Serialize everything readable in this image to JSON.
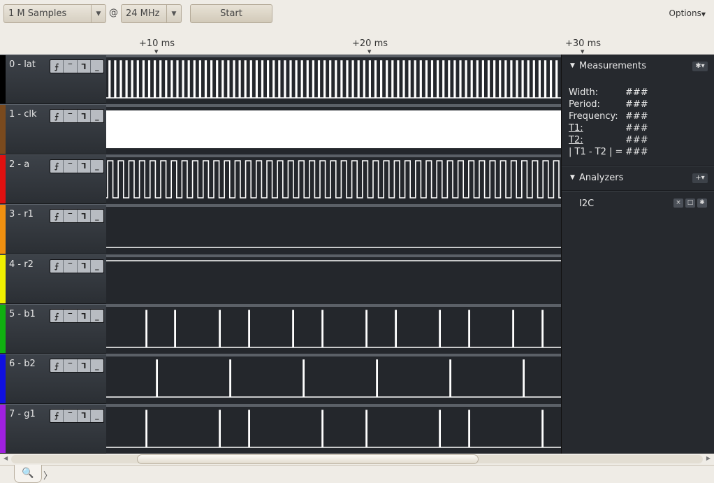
{
  "toolbar": {
    "samples": "1 M Samples",
    "at": "@",
    "rate": "24 MHz",
    "start_label": "Start",
    "options_label": "Options"
  },
  "ruler": {
    "ticks": [
      "+10 ms",
      "+20 ms",
      "+30 ms"
    ]
  },
  "channels": [
    {
      "name": "0 - lat",
      "color": "#000000",
      "signal": "fast-pulses"
    },
    {
      "name": "1 - clk",
      "color": "#7a4a1e",
      "signal": "dense-clock"
    },
    {
      "name": "2 - a",
      "color": "#e01010",
      "signal": "square-wave"
    },
    {
      "name": "3 - r1",
      "color": "#f09010",
      "signal": "low"
    },
    {
      "name": "4 - r2",
      "color": "#f0f000",
      "signal": "high"
    },
    {
      "name": "5 - b1",
      "color": "#10b010",
      "signal": "spikes"
    },
    {
      "name": "6 - b2",
      "color": "#1010e0",
      "signal": "spikes"
    },
    {
      "name": "7 - g1",
      "color": "#a020e0",
      "signal": "spikes"
    }
  ],
  "trigger_icons": [
    "rising-edge-icon",
    "high-level-icon",
    "falling-edge-icon",
    "low-level-icon"
  ],
  "measurements": {
    "title": "Measurements",
    "rows": [
      {
        "label": "Width:",
        "value": "###"
      },
      {
        "label": "Period:",
        "value": "###"
      },
      {
        "label": "Frequency:",
        "value": "###"
      },
      {
        "label": "T1:",
        "value": "###"
      },
      {
        "label": "T2:",
        "value": "###"
      },
      {
        "label": "| T1 - T2 | =",
        "value": "###"
      }
    ]
  },
  "analyzers": {
    "title": "Analyzers",
    "items": [
      {
        "name": "I2C"
      }
    ]
  }
}
